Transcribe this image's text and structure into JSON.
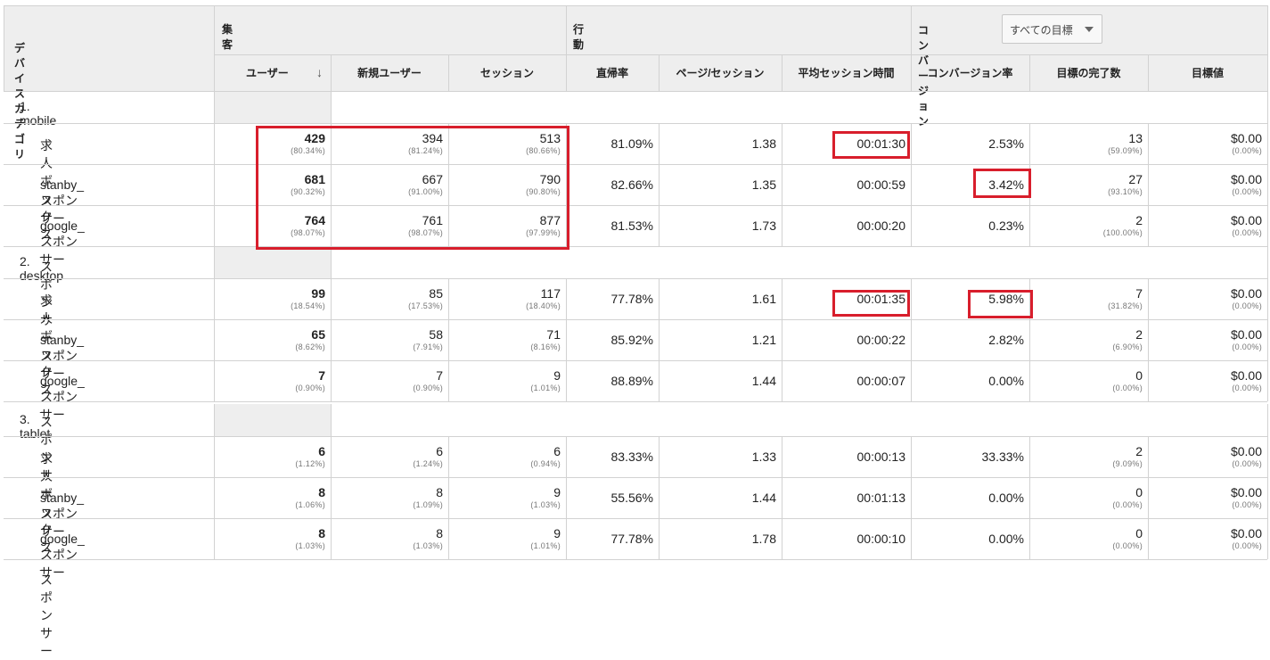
{
  "header": {
    "dimension_label": "デバイス カテゴリ",
    "groups": {
      "acquisition": "集客",
      "behavior": "行動",
      "conversion": "コンバージョン"
    },
    "goal_select": "すべての目標",
    "columns": [
      "ユーザー",
      "新規ユーザー",
      "セッション",
      "直帰率",
      "ページ/セッション",
      "平均セッション時間",
      "コンバージョン率",
      "目標の完了数",
      "目標値"
    ]
  },
  "devices": [
    {
      "label": "1.  mobile",
      "rows": [
        {
          "label": "求人ボックス_スポンサー",
          "users": "429",
          "users_pct": "(80.34%)",
          "new_users": "394",
          "new_users_pct": "(81.24%)",
          "sessions": "513",
          "sessions_pct": "(80.66%)",
          "bounce": "81.09%",
          "pps": "1.38",
          "duration": "00:01:30",
          "conv_rate": "2.53%",
          "goal_comp": "13",
          "goal_comp_pct": "(59.09%)",
          "goal_value": "$0.00",
          "goal_value_pct": "(0.00%)"
        },
        {
          "label": "stanby_スポンサー",
          "users": "681",
          "users_pct": "(90.32%)",
          "new_users": "667",
          "new_users_pct": "(91.00%)",
          "sessions": "790",
          "sessions_pct": "(90.80%)",
          "bounce": "82.66%",
          "pps": "1.35",
          "duration": "00:00:59",
          "conv_rate": "3.42%",
          "goal_comp": "27",
          "goal_comp_pct": "(93.10%)",
          "goal_value": "$0.00",
          "goal_value_pct": "(0.00%)"
        },
        {
          "label": "google_スポンサー",
          "users": "764",
          "users_pct": "(98.07%)",
          "new_users": "761",
          "new_users_pct": "(98.07%)",
          "sessions": "877",
          "sessions_pct": "(97.99%)",
          "bounce": "81.53%",
          "pps": "1.73",
          "duration": "00:00:20",
          "conv_rate": "0.23%",
          "goal_comp": "2",
          "goal_comp_pct": "(100.00%)",
          "goal_value": "$0.00",
          "goal_value_pct": "(0.00%)"
        }
      ]
    },
    {
      "label": "2.  desktop",
      "rows": [
        {
          "label": "求人ボックス_スポンサー",
          "users": "99",
          "users_pct": "(18.54%)",
          "new_users": "85",
          "new_users_pct": "(17.53%)",
          "sessions": "117",
          "sessions_pct": "(18.40%)",
          "bounce": "77.78%",
          "pps": "1.61",
          "duration": "00:01:35",
          "conv_rate": "5.98%",
          "goal_comp": "7",
          "goal_comp_pct": "(31.82%)",
          "goal_value": "$0.00",
          "goal_value_pct": "(0.00%)"
        },
        {
          "label": "stanby_スポンサー",
          "users": "65",
          "users_pct": "(8.62%)",
          "new_users": "58",
          "new_users_pct": "(7.91%)",
          "sessions": "71",
          "sessions_pct": "(8.16%)",
          "bounce": "85.92%",
          "pps": "1.21",
          "duration": "00:00:22",
          "conv_rate": "2.82%",
          "goal_comp": "2",
          "goal_comp_pct": "(6.90%)",
          "goal_value": "$0.00",
          "goal_value_pct": "(0.00%)"
        },
        {
          "label": "google_スポンサー",
          "users": "7",
          "users_pct": "(0.90%)",
          "new_users": "7",
          "new_users_pct": "(0.90%)",
          "sessions": "9",
          "sessions_pct": "(1.01%)",
          "bounce": "88.89%",
          "pps": "1.44",
          "duration": "00:00:07",
          "conv_rate": "0.00%",
          "goal_comp": "0",
          "goal_comp_pct": "(0.00%)",
          "goal_value": "$0.00",
          "goal_value_pct": "(0.00%)"
        }
      ]
    },
    {
      "label": "3.  tablet",
      "rows": [
        {
          "label": "求人ボックス_スポンサー",
          "users": "6",
          "users_pct": "(1.12%)",
          "new_users": "6",
          "new_users_pct": "(1.24%)",
          "sessions": "6",
          "sessions_pct": "(0.94%)",
          "bounce": "83.33%",
          "pps": "1.33",
          "duration": "00:00:13",
          "conv_rate": "33.33%",
          "goal_comp": "2",
          "goal_comp_pct": "(9.09%)",
          "goal_value": "$0.00",
          "goal_value_pct": "(0.00%)"
        },
        {
          "label": "stanby_スポンサー",
          "users": "8",
          "users_pct": "(1.06%)",
          "new_users": "8",
          "new_users_pct": "(1.09%)",
          "sessions": "9",
          "sessions_pct": "(1.03%)",
          "bounce": "55.56%",
          "pps": "1.44",
          "duration": "00:01:13",
          "conv_rate": "0.00%",
          "goal_comp": "0",
          "goal_comp_pct": "(0.00%)",
          "goal_value": "$0.00",
          "goal_value_pct": "(0.00%)"
        },
        {
          "label": "google_スポンサー",
          "users": "8",
          "users_pct": "(1.03%)",
          "new_users": "8",
          "new_users_pct": "(1.03%)",
          "sessions": "9",
          "sessions_pct": "(1.01%)",
          "bounce": "77.78%",
          "pps": "1.78",
          "duration": "00:00:10",
          "conv_rate": "0.00%",
          "goal_comp": "0",
          "goal_comp_pct": "(0.00%)",
          "goal_value": "$0.00",
          "goal_value_pct": "(0.00%)"
        }
      ]
    }
  ],
  "colors": {
    "highlight_box": "#d81e2c",
    "header_bg": "#eeeeee",
    "grid_line": "#d2d2d2",
    "sub_text": "#777777"
  }
}
